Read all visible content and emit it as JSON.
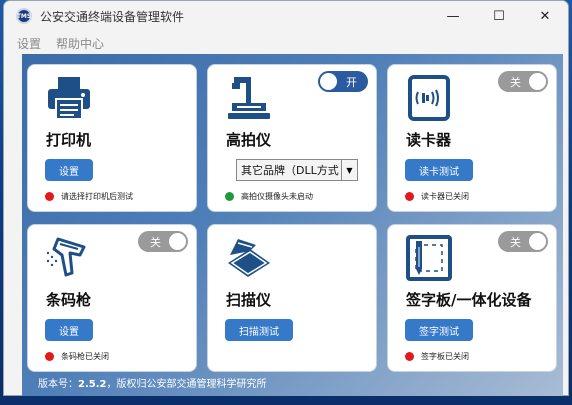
{
  "window": {
    "title": "公安交通终端设备管理软件",
    "app_icon_text": "TMS",
    "controls": {
      "minimize": "—",
      "maximize": "☐",
      "close": "✕"
    }
  },
  "menu": [
    "设置",
    "帮助中心"
  ],
  "devices": {
    "printer": {
      "name": "打印机",
      "button": "设置",
      "status": "请选择打印机后测试",
      "status_color": "red",
      "icon": "printer-icon"
    },
    "camera": {
      "name": "高拍仪",
      "toggle": "开",
      "toggle_state": "on",
      "select_value": "其它品牌（DLL方式",
      "status": "高拍仪摄像头未启动",
      "status_color": "green",
      "icon": "document-camera-icon"
    },
    "card_reader": {
      "name": "读卡器",
      "toggle": "关",
      "toggle_state": "off",
      "button": "读卡测试",
      "status": "读卡器已关闭",
      "status_color": "red",
      "icon": "card-reader-icon"
    },
    "barcode": {
      "name": "条码枪",
      "toggle": "关",
      "toggle_state": "off",
      "button": "设置",
      "status": "条码枪已关闭",
      "status_color": "red",
      "icon": "barcode-scanner-icon"
    },
    "scanner": {
      "name": "扫描仪",
      "button": "扫描测试",
      "icon": "flatbed-scanner-icon"
    },
    "signature": {
      "name": "签字板/一体化设备",
      "toggle": "关",
      "toggle_state": "off",
      "button": "签字测试",
      "status": "签字板已关闭",
      "status_color": "red",
      "icon": "signature-pad-icon"
    }
  },
  "footer": {
    "version_label": "版本号：",
    "version": "2.5.2",
    "copyright": "，版权归公安部交通管理科学研究所"
  },
  "colors": {
    "accent": "#3779c9",
    "toggle_on": "#2c5aa0",
    "toggle_off": "#9a9a9a",
    "status_red": "#e31a1a",
    "status_green": "#1f9a3a"
  }
}
